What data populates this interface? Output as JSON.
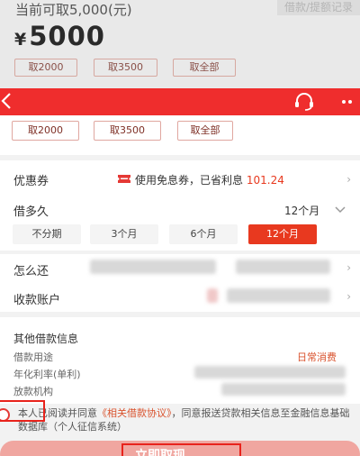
{
  "background": {
    "available_text": "当前可取5,000(元)",
    "records_tag": "借款/提额记录",
    "amount": "5000",
    "currency": "¥",
    "chips": [
      "取2000",
      "取3500",
      "取全部"
    ]
  },
  "chips": [
    "取2000",
    "取3500",
    "取全部"
  ],
  "coupon": {
    "label": "优惠券",
    "icon": "ticket-icon",
    "value": "使用免息券，已省利息",
    "saved": "101.24"
  },
  "term": {
    "label": "借多久",
    "selected_value": "12个月",
    "options": [
      "不分期",
      "3个月",
      "6个月",
      "12个月"
    ]
  },
  "repay": {
    "label": "怎么还"
  },
  "account": {
    "label": "收款账户"
  },
  "other_info": {
    "title": "其他借款信息",
    "purpose_label": "借款用途",
    "purpose_value": "日常消费",
    "rate_label": "年化利率(单利)",
    "lender_label": "放款机构"
  },
  "agreement": {
    "prefix": "本人已阅读并同意",
    "link": "《相关借款协议》",
    "suffix": "，同意报送贷款相关信息至金融信息基础数据库（个人征信系统）"
  },
  "submit_label": "立即取现",
  "colors": {
    "brand_red": "#ef2d2d",
    "selected": "#e8391f",
    "link": "#d9532e"
  }
}
